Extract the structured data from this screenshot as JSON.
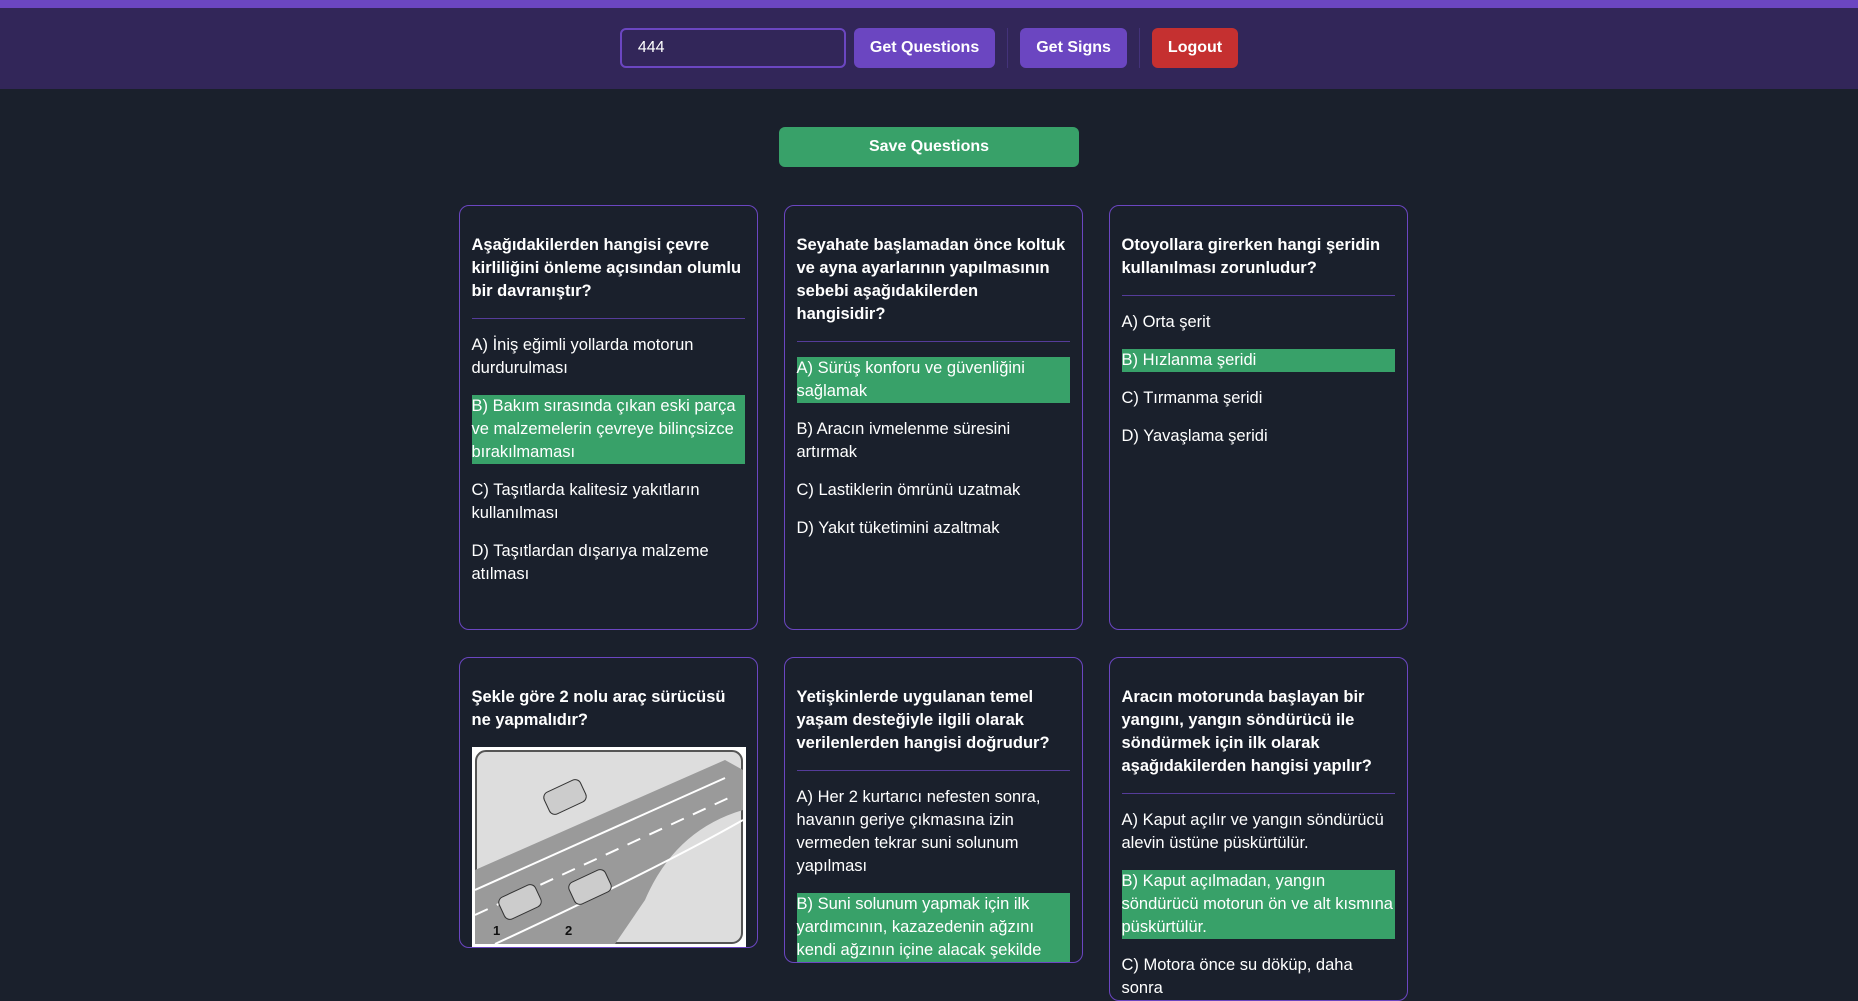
{
  "header": {
    "search_value": "444",
    "get_questions": "Get Questions",
    "get_signs": "Get Signs",
    "logout": "Logout"
  },
  "save_label": "Save Questions",
  "colors": {
    "accent": "#6b46c1",
    "header": "#322659",
    "correct": "#38a169",
    "logout": "#c53030",
    "background": "#1a202c"
  },
  "questions": [
    {
      "text": "Aşağıdakilerden hangisi çevre kirliliğini önleme açısından olumlu bir davranıştır?",
      "options": [
        "A) İniş eğimli yollarda motorun durdurulması",
        "B) Bakım sırasında çıkan eski parça ve malzemelerin çevreye bilinçsizce bırakılmaması",
        "C) Taşıtlarda kalitesiz yakıtların kullanılması",
        "D) Taşıtlardan dışarıya malzeme atılması"
      ],
      "correct": 1
    },
    {
      "text": "Seyahate başlamadan önce koltuk ve ayna ayarlarının yapılmasının sebebi aşağıdakilerden hangisidir?",
      "options": [
        "A) Sürüş konforu ve güvenliğini sağlamak",
        "B) Aracın ivmelenme süresini artırmak",
        "C) Lastiklerin ömrünü uzatmak",
        "D) Yakıt tüketimini azaltmak"
      ],
      "correct": 0
    },
    {
      "text": "Otoyollara girerken hangi şeridin kullanılması zorunludur?",
      "options": [
        "A) Orta şerit",
        "B) Hızlanma şeridi",
        "C) Tırmanma şeridi",
        "D) Yavaşlama şeridi"
      ],
      "correct": 1
    },
    {
      "text": "Şekle göre 2 nolu araç sürücüsü ne yapmalıdır?",
      "image": "road-merge-illustration",
      "image_labels": [
        "1",
        "2"
      ],
      "options": []
    },
    {
      "text": "Yetişkinlerde uygulanan temel yaşam desteğiyle ilgili olarak verilenlerden hangisi doğrudur?",
      "options": [
        "A) Her 2 kurtarıcı nefesten sonra, havanın geriye çıkmasına izin vermeden tekrar suni solunum yapılması",
        "B) Suni solunum yapmak için ilk yardımcının, kazazedenin ağzını kendi ağzının içine alacak şekilde"
      ],
      "correct": 1
    },
    {
      "text": "Aracın motorunda başlayan bir yangını, yangın söndürücü ile söndürmek için ilk olarak aşağıdakilerden hangisi yapılır?",
      "options": [
        "A) Kaput açılır ve yangın söndürücü alevin üstüne püskürtülür.",
        "B) Kaput açılmadan, yangın söndürücü motorun ön ve alt kısmına püskürtülür.",
        "C) Motora önce su döküp, daha sonra"
      ],
      "correct": 1
    }
  ]
}
